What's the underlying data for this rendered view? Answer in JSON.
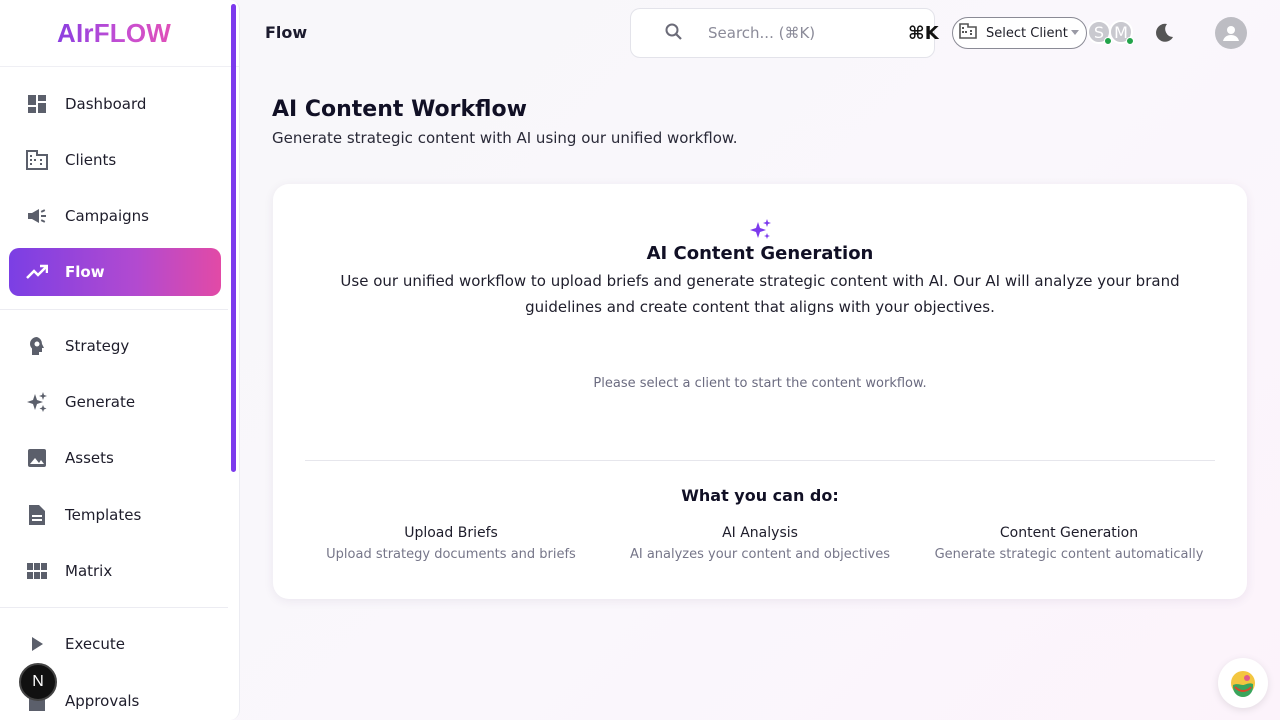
{
  "brand": {
    "logo": "AIrFLOW"
  },
  "sidebar": {
    "items": [
      {
        "label": "Dashboard",
        "icon": "dashboard-icon"
      },
      {
        "label": "Clients",
        "icon": "building-icon"
      },
      {
        "label": "Campaigns",
        "icon": "megaphone-icon"
      },
      {
        "label": "Flow",
        "icon": "trending-up-icon",
        "active": true
      },
      {
        "label": "Strategy",
        "icon": "psychology-icon"
      },
      {
        "label": "Generate",
        "icon": "sparkle-icon"
      },
      {
        "label": "Assets",
        "icon": "image-icon"
      },
      {
        "label": "Templates",
        "icon": "document-icon"
      },
      {
        "label": "Matrix",
        "icon": "grid-icon"
      },
      {
        "label": "Execute",
        "icon": "play-icon"
      },
      {
        "label": "Approvals",
        "icon": "approval-icon"
      }
    ],
    "dev_badge": "N"
  },
  "header": {
    "page": "Flow",
    "search": {
      "placeholder": "Search... (⌘K)",
      "shortcut": "⌘K"
    },
    "client_select": {
      "label": "Select Client"
    },
    "presence": [
      {
        "initial": "S"
      },
      {
        "initial": "M"
      }
    ]
  },
  "main": {
    "title": "AI Content Workflow",
    "subtitle": "Generate strategic content with AI using our unified workflow.",
    "card": {
      "title": "AI Content Generation",
      "description": "Use our unified workflow to upload briefs and generate strategic content with AI. Our AI will analyze your brand guidelines and create content that aligns with your objectives.",
      "hint": "Please select a client to start the content workflow.",
      "features_title": "What you can do:",
      "features": [
        {
          "title": "Upload Briefs",
          "desc": "Upload strategy documents and briefs"
        },
        {
          "title": "AI Analysis",
          "desc": "AI analyzes your content and objectives"
        },
        {
          "title": "Content Generation",
          "desc": "Generate strategic content automatically"
        }
      ]
    }
  },
  "colors": {
    "accent": "#7c3aed",
    "pink": "#e24aa6",
    "online": "#22a34a"
  }
}
